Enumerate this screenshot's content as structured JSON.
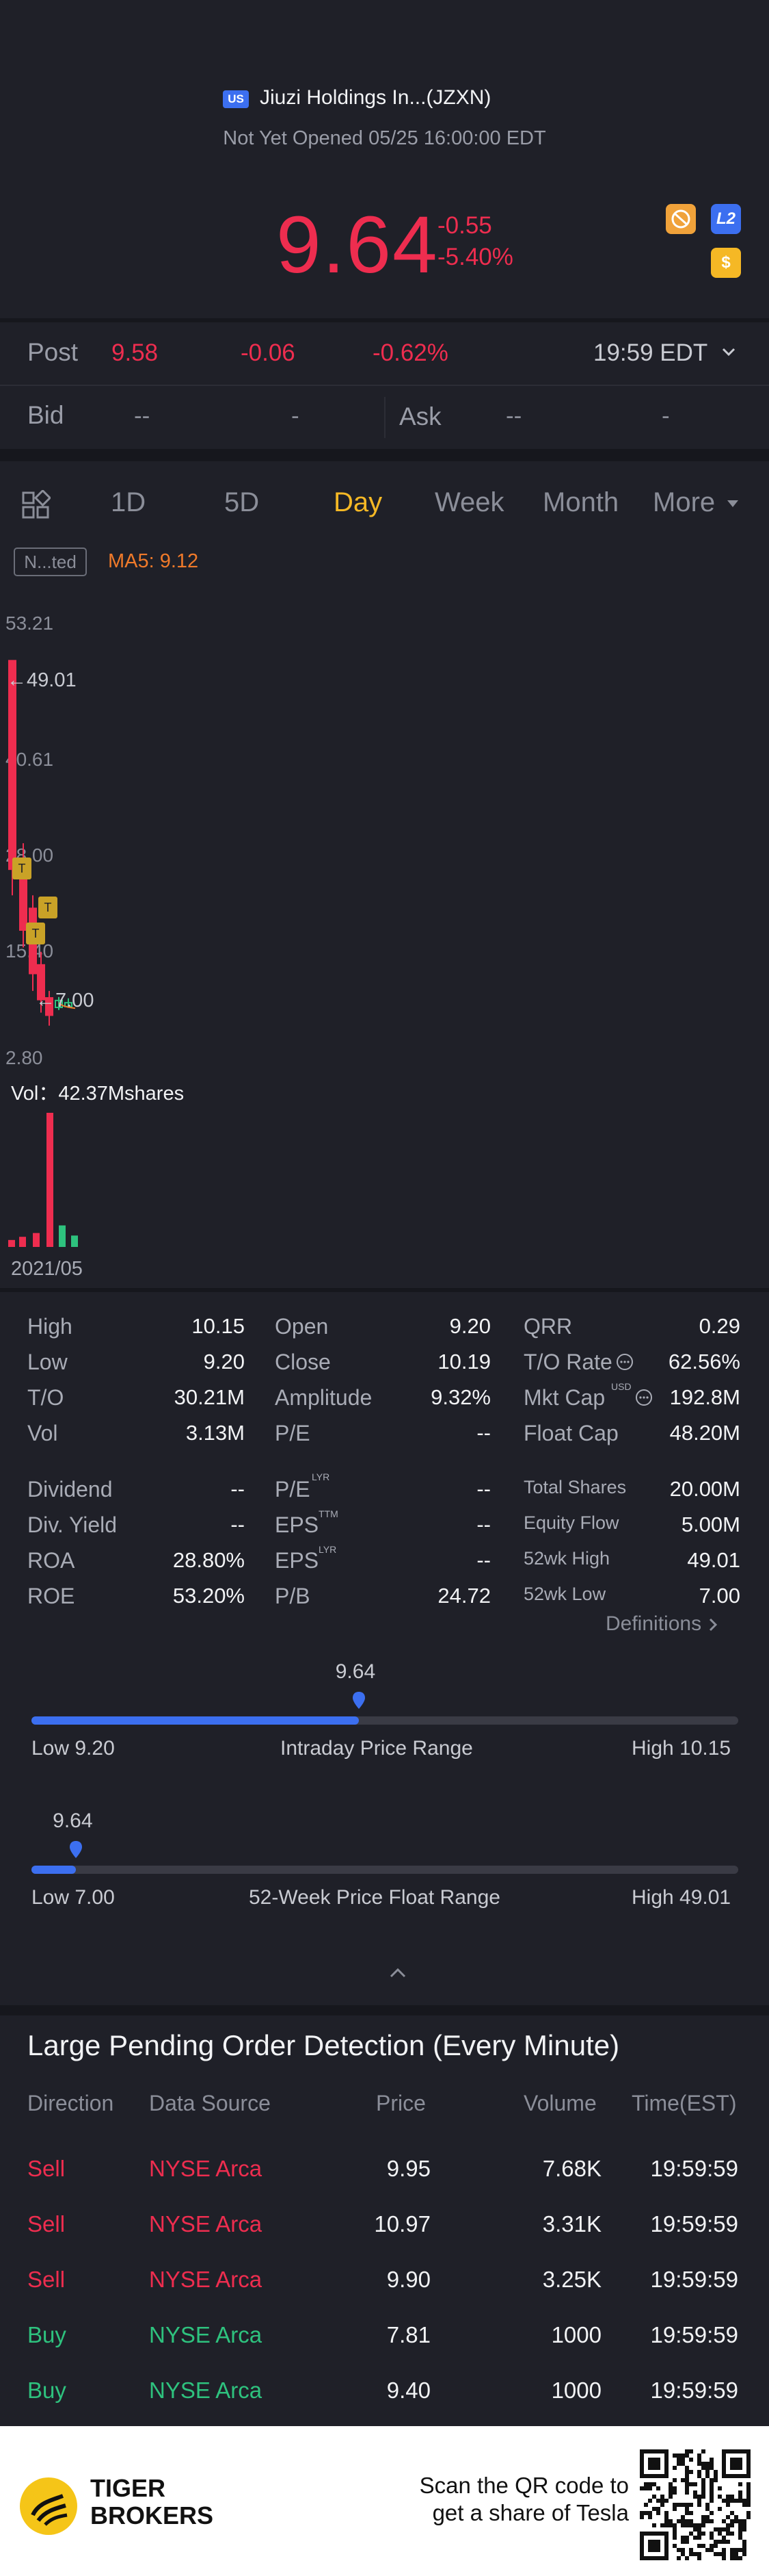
{
  "header": {
    "market_badge": "US",
    "stock_name": "Jiuzi Holdings In...(JZXN)",
    "status": "Not Yet Opened 05/25 16:00:00 EDT",
    "price": "9.64",
    "change": "-0.55",
    "change_pct": "-5.40%",
    "l2_label": "L2",
    "dollar_label": "$"
  },
  "post": {
    "label": "Post",
    "price": "9.58",
    "change": "-0.06",
    "change_pct": "-0.62%",
    "time": "19:59 EDT"
  },
  "quote": {
    "bid_label": "Bid",
    "bid_price": "--",
    "bid_size": "-",
    "ask_label": "Ask",
    "ask_price": "--",
    "ask_size": "-"
  },
  "tabs": [
    "1D",
    "5D",
    "Day",
    "Week",
    "Month",
    "More"
  ],
  "active_tab": "Day",
  "chart": {
    "indicator_box": "N...ted",
    "ma_label": "MA5: 9.12",
    "y_top": "53.21",
    "y_2": "40.61",
    "y_3": "28.00",
    "y_4": "15.40",
    "y_bottom": "2.80",
    "high_marker": "49.01",
    "low_marker": "7.00",
    "vol_label": "Vol：42.37Mshares",
    "date_label": "2021/05",
    "colors": {
      "up": "#ee2d4f",
      "down": "#2ec27e",
      "ma": "#f07a2a",
      "marker": "#c9a227"
    }
  },
  "chart_data": {
    "type": "candlestick",
    "ylim": [
      2.8,
      53.21
    ],
    "candles": [
      {
        "open": 49.01,
        "close": 25.0,
        "high": 49.01,
        "low": 22.0,
        "dir": "down"
      },
      {
        "open": 24.0,
        "close": 18.0,
        "high": 28.0,
        "low": 16.0,
        "dir": "down"
      },
      {
        "open": 20.5,
        "close": 13.0,
        "high": 22.0,
        "low": 11.0,
        "dir": "down"
      },
      {
        "open": 14.0,
        "close": 10.0,
        "high": 15.5,
        "low": 8.5,
        "dir": "down"
      },
      {
        "open": 10.2,
        "close": 8.2,
        "high": 11.0,
        "low": 7.0,
        "dir": "down"
      },
      {
        "open": 9.9,
        "close": 9.1,
        "high": 10.3,
        "low": 8.8,
        "dir": "up"
      },
      {
        "open": 9.2,
        "close": 9.64,
        "high": 10.15,
        "low": 9.2,
        "dir": "up"
      }
    ],
    "volumes": [
      {
        "value": 2.2,
        "dir": "down"
      },
      {
        "value": 3.2,
        "dir": "down"
      },
      {
        "value": 4.4,
        "dir": "down"
      },
      {
        "value": 42.37,
        "dir": "down"
      },
      {
        "value": 6.8,
        "dir": "up"
      },
      {
        "value": 3.6,
        "dir": "up"
      }
    ],
    "vol_max": 42.37
  },
  "stats": [
    [
      {
        "label": "High",
        "value": "10.15"
      },
      {
        "label": "Open",
        "value": "9.20"
      },
      {
        "label": "QRR",
        "value": "0.29"
      }
    ],
    [
      {
        "label": "Low",
        "value": "9.20"
      },
      {
        "label": "Close",
        "value": "10.19"
      },
      {
        "label": "T/O Rate",
        "value": "62.56%"
      }
    ],
    [
      {
        "label": "T/O",
        "value": "30.21M"
      },
      {
        "label": "Amplitude",
        "value": "9.32%"
      },
      {
        "label": "Mkt Cap",
        "value": "192.8M"
      }
    ],
    [
      {
        "label": "Vol",
        "value": "3.13M"
      },
      {
        "label": "P/E",
        "value": "--"
      },
      {
        "label": "Float Cap",
        "value": "48.20M"
      }
    ],
    [
      {
        "label": "Dividend",
        "value": "--"
      },
      {
        "label": "P/E",
        "value": "--"
      },
      {
        "label": "Total Shares",
        "value": "20.00M"
      }
    ],
    [
      {
        "label": "Div. Yield",
        "value": "--"
      },
      {
        "label": "EPS",
        "value": "--"
      },
      {
        "label": "Equity Flow",
        "value": "5.00M"
      }
    ],
    [
      {
        "label": "ROA",
        "value": "28.80%"
      },
      {
        "label": "EPS",
        "value": "--"
      },
      {
        "label": "52wk High",
        "value": "49.01"
      }
    ],
    [
      {
        "label": "ROE",
        "value": "53.20%"
      },
      {
        "label": "P/B",
        "value": "24.72"
      },
      {
        "label": "52wk Low",
        "value": "7.00"
      }
    ]
  ],
  "sup": {
    "lyr": "LYR",
    "ttm": "TTM",
    "usd": "USD"
  },
  "definitions_label": "Definitions",
  "intraday": {
    "current": "9.64",
    "low": "Low 9.20",
    "title": "Intraday Price Range",
    "high": "High 10.15",
    "fraction": 0.463
  },
  "week52": {
    "current": "9.64",
    "low": "Low 7.00",
    "title": "52-Week Price Float Range",
    "high": "High 49.01",
    "fraction": 0.063
  },
  "orders": {
    "title": "Large Pending Order Detection (Every Minute)",
    "headers": [
      "Direction",
      "Data Source",
      "Price",
      "Volume",
      "Time(EST)"
    ],
    "rows": [
      {
        "dir": "Sell",
        "source": "NYSE Arca",
        "price": "9.95",
        "volume": "7.68K",
        "time": "19:59:59"
      },
      {
        "dir": "Sell",
        "source": "NYSE Arca",
        "price": "10.97",
        "volume": "3.31K",
        "time": "19:59:59"
      },
      {
        "dir": "Sell",
        "source": "NYSE Arca",
        "price": "9.90",
        "volume": "3.25K",
        "time": "19:59:59"
      },
      {
        "dir": "Buy",
        "source": "NYSE Arca",
        "price": "7.81",
        "volume": "1000",
        "time": "19:59:59"
      },
      {
        "dir": "Buy",
        "source": "NYSE Arca",
        "price": "9.40",
        "volume": "1000",
        "time": "19:59:59"
      }
    ]
  },
  "footer": {
    "brand_line1": "TIGER",
    "brand_line2": "BROKERS",
    "cta_line1": "Scan the QR code to",
    "cta_line2": "get a share of Tesla"
  }
}
